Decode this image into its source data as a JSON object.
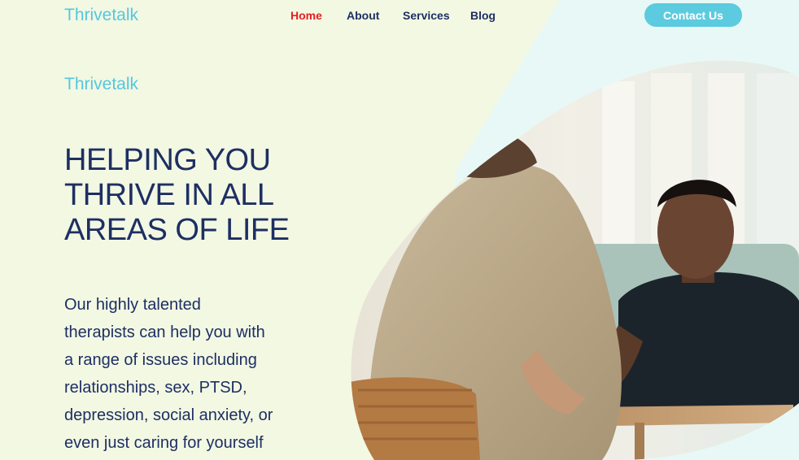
{
  "header": {
    "logo": "Thrivetalk",
    "nav": [
      {
        "label": "Home",
        "active": true
      },
      {
        "label": "About",
        "active": false
      },
      {
        "label": "Services",
        "active": false
      },
      {
        "label": "Blog",
        "active": false
      }
    ],
    "cta": "Contact Us"
  },
  "hero": {
    "brand": "Thrivetalk",
    "headline_lines": [
      "HELPING YOU",
      "THRIVE IN ALL",
      "AREAS OF LIFE"
    ],
    "body_lines": [
      "Our highly talented",
      "therapists can help you with",
      "a range of issues including",
      "relationships, sex, PTSD,",
      "depression, social anxiety, or",
      "even just caring for yourself"
    ],
    "image": "therapy-session-photo"
  },
  "colors": {
    "background": "#f3f8e3",
    "accent": "#5ccbdf",
    "navy": "#1d2f63",
    "active_nav": "#e11f22"
  }
}
